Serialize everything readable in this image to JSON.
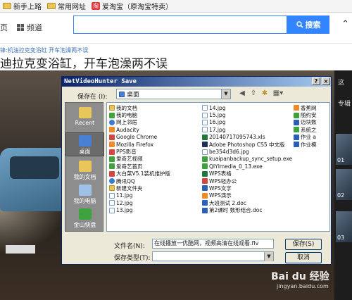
{
  "favorites": [
    "新手上路",
    "常用网址",
    "爱淘宝（原淘宝特卖）"
  ],
  "header": {
    "tab_partial": "页",
    "channel": "频道",
    "search_button": "搜索",
    "search_value": ""
  },
  "breadcrumb": "锋:机油拉克变浴缸 开车泡澡两不误",
  "page_title": "迪拉克变浴缸，开车泡澡两不误",
  "video": {
    "plate": ""
  },
  "sidebar": {
    "top_label": "这",
    "mid_label": "专辑",
    "thumb_nums": [
      "01",
      "02",
      "03"
    ]
  },
  "dialog": {
    "title": "NetVideoHunter Save",
    "help_btn": "?",
    "close_btn": "×",
    "save_in_label": "保存在 (I):",
    "save_in_value": "桌面",
    "places": [
      "Recent",
      "桌面",
      "我的文档",
      "我的电脑",
      "金山快盘"
    ],
    "files_col1": [
      {
        "name": "我的文档",
        "icon": "folder"
      },
      {
        "name": "我的电脑",
        "icon": "app"
      },
      {
        "name": "网上邻居",
        "icon": "ie"
      },
      {
        "name": "Audacity",
        "icon": "orange"
      },
      {
        "name": "Google Chrome",
        "icon": "red"
      },
      {
        "name": "Mozilla Firefox",
        "icon": "orange"
      },
      {
        "name": "PPS影音",
        "icon": "red"
      },
      {
        "name": "爱奇艺视频",
        "icon": "app"
      },
      {
        "name": "爱奇艺首页",
        "icon": "app"
      },
      {
        "name": "大白菜V5.1装机维护版",
        "icon": "red"
      },
      {
        "name": "腾讯QQ",
        "icon": "ie"
      },
      {
        "name": "新建文件夹",
        "icon": "folder"
      },
      {
        "name": "11.jpg",
        "icon": "jpg"
      },
      {
        "name": "12.jpg",
        "icon": "jpg"
      },
      {
        "name": "13.jpg",
        "icon": "jpg"
      }
    ],
    "files_col2": [
      {
        "name": "14.jpg",
        "icon": "jpg"
      },
      {
        "name": "15.jpg",
        "icon": "jpg"
      },
      {
        "name": "16.jpg",
        "icon": "jpg"
      },
      {
        "name": "17.jpg",
        "icon": "jpg"
      },
      {
        "name": "20140717095743.xls",
        "icon": "xls"
      },
      {
        "name": "Adobe Photoshop CS5 中文版",
        "icon": "ps"
      },
      {
        "name": "be354d3d6.jpg",
        "icon": "jpg"
      },
      {
        "name": "kuaipanbackup_sync_setup.exe",
        "icon": "app"
      },
      {
        "name": "QIYImedia_0_13.exe",
        "icon": "app"
      },
      {
        "name": "WPS表格",
        "icon": "xls"
      },
      {
        "name": "WPS轻办公",
        "icon": "red"
      },
      {
        "name": "WPS文字",
        "icon": "doc"
      },
      {
        "name": "WPS演示",
        "icon": "orange"
      },
      {
        "name": "大班测试 2.doc",
        "icon": "doc"
      },
      {
        "name": "第2课时 数形结合.doc",
        "icon": "doc"
      }
    ],
    "files_col3": [
      {
        "name": "香蕉网",
        "icon": "orange"
      },
      {
        "name": "随约安",
        "icon": "app"
      },
      {
        "name": "迈块数",
        "icon": "doc"
      },
      {
        "name": "系统之",
        "icon": "app"
      },
      {
        "name": "作业 a",
        "icon": "doc"
      },
      {
        "name": "作业模",
        "icon": "doc"
      }
    ],
    "filename_label": "文件名(N):",
    "filename_value": "在线播放一优酷网，视频高清在线观看.flv",
    "filetype_label": "保存类型(T):",
    "filetype_value": "",
    "save_btn": "保存(S)",
    "cancel_btn": "取消"
  },
  "watermark": {
    "logo": "Bai du 经验",
    "url": "jingyan.baidu.com"
  },
  "colors": {
    "accent": "#3385ff",
    "dialog_title": "#0a246a",
    "dialog_bg": "#ece9d8"
  }
}
